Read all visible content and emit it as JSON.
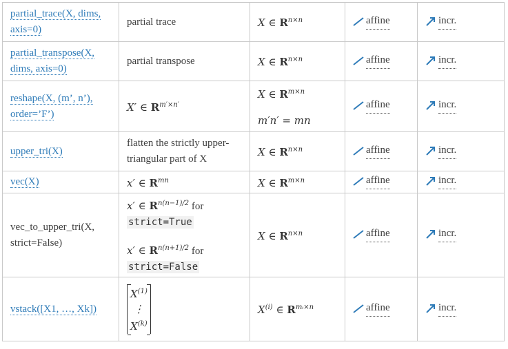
{
  "rows": [
    {
      "func": "partial_trace(X, dims, axis=0)",
      "desc": "partial trace",
      "domain": "X ∈ R",
      "domain_sup": "n×n",
      "curv": "affine",
      "mono": "incr."
    },
    {
      "func": "partial_transpose(X, dims, axis=0)",
      "desc": "partial transpose",
      "domain": "X ∈ R",
      "domain_sup": "n×n",
      "curv": "affine",
      "mono": "incr."
    },
    {
      "func": "reshape(X, (m’, n’), order=’F’)",
      "desc": "X′ ∈ R",
      "desc_sup": "m′×n′",
      "domain": "X ∈ R",
      "domain_sup": "m×n",
      "domain2": "m′n′ = mn",
      "curv": "affine",
      "mono": "incr."
    },
    {
      "func": "upper_tri(X)",
      "desc": "flatten the strictly upper-triangular part of X",
      "domain": "X ∈ R",
      "domain_sup": "n×n",
      "curv": "affine",
      "mono": "incr."
    },
    {
      "func": "vec(X)",
      "desc": "x′ ∈ R",
      "desc_sup": "mn",
      "domain": "X ∈ R",
      "domain_sup": "m×n",
      "curv": "affine",
      "mono": "incr."
    },
    {
      "func": "vec_to_upper_tri(X, strict=False)",
      "desc_a": "x′ ∈ R",
      "desc_a_sup": "n(n−1)/2",
      "desc_a_tail": " for",
      "desc_a_code": "strict=True",
      "desc_b": "x′ ∈ R",
      "desc_b_sup": "n(n+1)/2",
      "desc_b_tail": " for",
      "desc_b_code": "strict=False",
      "domain": "X ∈ R",
      "domain_sup": "n×n",
      "curv": "affine",
      "mono": "incr."
    },
    {
      "func": "vstack([X1, …, Xk])",
      "stack_top": "X",
      "stack_top_sup": "(1)",
      "stack_mid": "⋮",
      "stack_bot": "X",
      "stack_bot_sup": "(k)",
      "domain": "X",
      "domain_sup1": "(i)",
      "domain_mid": " ∈ R",
      "domain_sup": "mᵢ×n",
      "curv": "affine",
      "mono": "incr."
    }
  ],
  "colors": {
    "link": "#2e7bb8",
    "affine_icon": "#2e7bb8",
    "incr_icon": "#2e7bb8",
    "border": "#c9c9c9"
  },
  "icons": {
    "curvature": "affine-line-icon",
    "monotonicity": "increasing-arrow-icon"
  }
}
